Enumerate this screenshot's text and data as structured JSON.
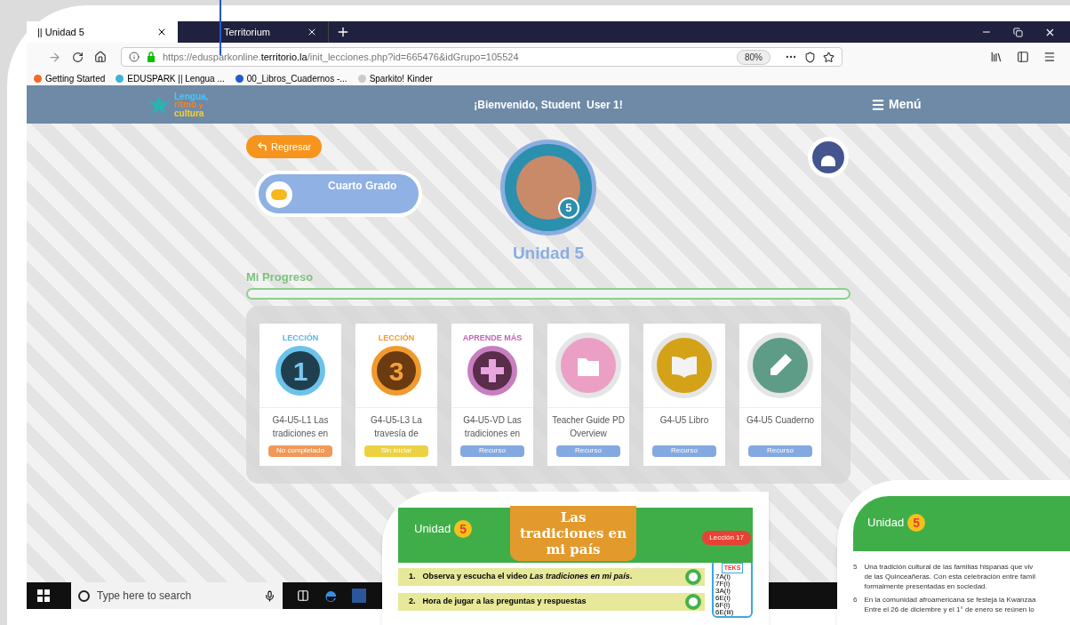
{
  "browser": {
    "tabs": [
      {
        "label": "|| Unidad 5",
        "selected": true
      },
      {
        "label": "Territorium",
        "selected": false
      }
    ],
    "url": {
      "prefix": "https://edusparkonline.",
      "domain": "territorio.la",
      "path": "/init_lecciones.php?id=665476&idGrupo=105524"
    },
    "zoom": "80%",
    "bookmarks": [
      "Getting Started",
      "EDUSPARK || Lengua ...",
      "00_Libros_Cuadernos -...",
      "Sparkito! Kinder"
    ]
  },
  "header": {
    "logo": [
      "Lengua,",
      "ritmo",
      "y",
      "cultura"
    ],
    "welcome": "¡Bienvenido, Student  User 1!",
    "menu": "Menú"
  },
  "back_button": "Regresar",
  "grade": "Cuarto Grado",
  "unit": {
    "number": "5",
    "title": "Unidad 5"
  },
  "progress": {
    "label": "Mi Progreso",
    "level": 0
  },
  "cards": [
    {
      "kind": "lesson",
      "art_label": "LECCIÓN",
      "art_number": "1",
      "title": "G4-U5-L1 Las tradiciones en",
      "status": "No completado",
      "color": "#f0995a"
    },
    {
      "kind": "lesson",
      "art_label": "LECCIÓN",
      "art_number": "3",
      "title": "G4-U5-L3 La travesía de",
      "status": "Sin iniciar",
      "color": "#ecd243"
    },
    {
      "kind": "extra",
      "art_label": "APRENDE MÁS",
      "title": "G4-U5-VD Las tradiciones en",
      "status": "Recurso",
      "color": "#84a9e0"
    },
    {
      "kind": "folder",
      "title": "Teacher Guide PD Overview",
      "status": "Recurso",
      "color": "#84a9e0"
    },
    {
      "kind": "book",
      "title": "G4-U5 Libro",
      "status": "Recurso",
      "color": "#84a9e0"
    },
    {
      "kind": "pencil",
      "title": "G4-U5 Cuaderno",
      "status": "Recurso",
      "color": "#84a9e0"
    }
  ],
  "taskbar": {
    "search_placeholder": "Type here to search"
  },
  "page_one": {
    "unit_label": "Unidad",
    "unit_number": "5",
    "title": "Las tradiciones en mi país",
    "lesson": "Lección 17",
    "teks_logo": "TEKS",
    "teks_codes": [
      "7A(i)",
      "7F(i)",
      "3A(i)",
      "6E(i)",
      "6F(i)",
      "6E(iii)"
    ],
    "steps": [
      {
        "number": "1.",
        "text": "Observa y escucha el video *Las tradiciones en mi país*."
      },
      {
        "number": "2.",
        "text": "Hora de jugar a las preguntas y respuestas"
      }
    ]
  },
  "page_two": {
    "unit_label": "Unidad",
    "unit_number": "5",
    "paragraphs": [
      {
        "number": "5",
        "lines": [
          "Una tradición cultural de las familias hispanas que viv",
          "de las Quinceañeras. Con esta celebración entre famil",
          "formalmente presentadas en sociedad."
        ]
      },
      {
        "number": "6",
        "lines": [
          "En la comunidad afroamericana se festeja la Kwanzaa",
          "Entre el 26 de diciembre y el 1° de enero se reúnen lo"
        ]
      }
    ]
  }
}
